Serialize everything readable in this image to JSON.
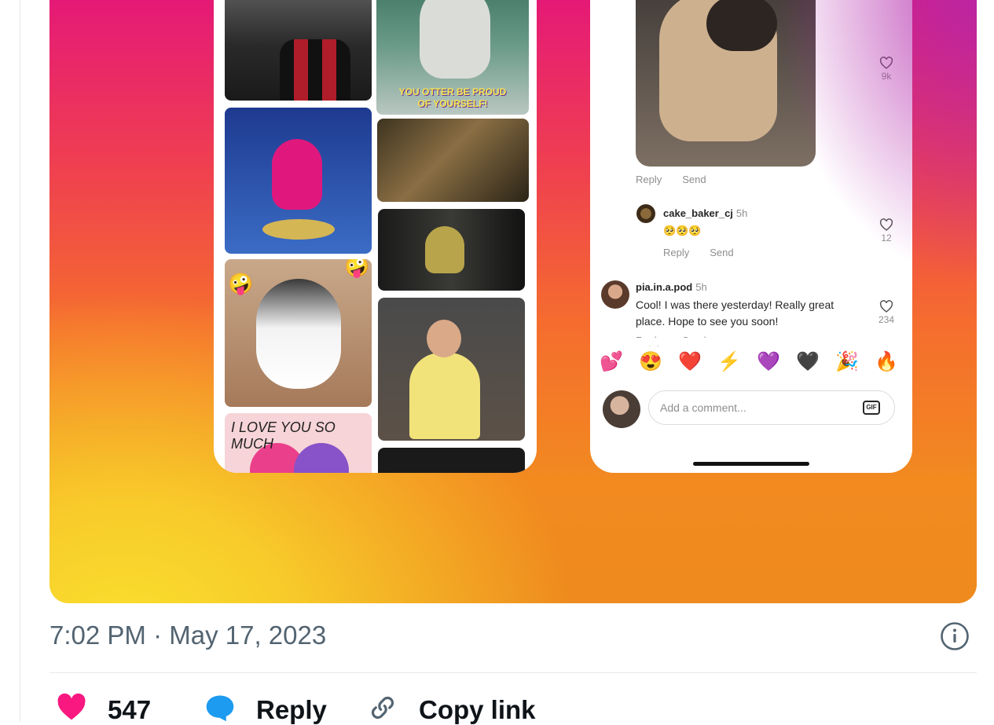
{
  "phone_right": {
    "post_likes": "9k",
    "post_actions": {
      "reply": "Reply",
      "send": "Send"
    },
    "comments": [
      {
        "user": "cake_baker_cj",
        "time": "5h",
        "text": "🥺🥺🥺",
        "likes": "12",
        "reply": "Reply",
        "send": "Send"
      },
      {
        "user": "pia.in.a.pod",
        "time": "5h",
        "text_line1": "Cool! I was there yesterday! Really great",
        "text_line2": "place. Hope to see you soon!",
        "likes": "234",
        "reply": "Reply",
        "send": "Send"
      }
    ],
    "reactions": [
      "💕",
      "😍",
      "❤️",
      "⚡",
      "💜",
      "🖤",
      "🎉",
      "🔥"
    ],
    "comment_input": {
      "placeholder": "Add a comment...",
      "gif_label": "GIF"
    }
  },
  "phone_left": {
    "otter_caption_line1": "YOU OTTER BE PROUD",
    "otter_caption_line2": "OF YOURSELF!",
    "donut_caption": "I LOVE YOU SO MUCH",
    "husky_emoji": "🤪"
  },
  "tweet": {
    "timestamp": "7:02 PM · May 17, 2023",
    "like_count": "547",
    "reply_label": "Reply",
    "copy_link_label": "Copy link"
  },
  "colors": {
    "like": "#f91880",
    "reply": "#1d9bf0",
    "muted": "#536471"
  },
  "icons": [
    "info-icon",
    "heart-icon",
    "reply-bubble-icon",
    "link-icon",
    "gif-icon"
  ]
}
